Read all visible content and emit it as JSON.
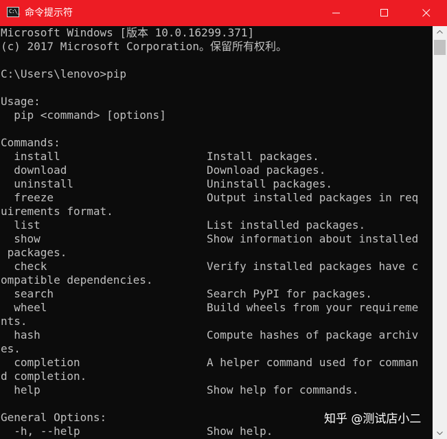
{
  "window": {
    "title": "命令提示符",
    "icon_text": "C:\\_"
  },
  "console": {
    "lines": [
      {
        "text": "Microsoft Windows [版本 10.0.16299.371]",
        "desc": ""
      },
      {
        "text": "(c) 2017 Microsoft Corporation。保留所有权利。",
        "desc": ""
      },
      {
        "text": "",
        "desc": ""
      },
      {
        "text": "C:\\Users\\lenovo>pip",
        "desc": ""
      },
      {
        "text": "",
        "desc": ""
      },
      {
        "text": "Usage:",
        "desc": ""
      },
      {
        "text": "  pip <command> [options]",
        "desc": ""
      },
      {
        "text": "",
        "desc": ""
      },
      {
        "text": "Commands:",
        "desc": ""
      },
      {
        "text": "  install",
        "desc": "Install packages."
      },
      {
        "text": "  download",
        "desc": "Download packages."
      },
      {
        "text": "  uninstall",
        "desc": "Uninstall packages."
      },
      {
        "text": "  freeze",
        "desc": "Output installed packages in req"
      },
      {
        "text": "uirements format.",
        "desc": ""
      },
      {
        "text": "  list",
        "desc": "List installed packages."
      },
      {
        "text": "  show",
        "desc": "Show information about installed"
      },
      {
        "text": " packages.",
        "desc": ""
      },
      {
        "text": "  check",
        "desc": "Verify installed packages have c"
      },
      {
        "text": "ompatible dependencies.",
        "desc": ""
      },
      {
        "text": "  search",
        "desc": "Search PyPI for packages."
      },
      {
        "text": "  wheel",
        "desc": "Build wheels from your requireme"
      },
      {
        "text": "nts.",
        "desc": ""
      },
      {
        "text": "  hash",
        "desc": "Compute hashes of package archiv"
      },
      {
        "text": "es.",
        "desc": ""
      },
      {
        "text": "  completion",
        "desc": "A helper command used for comman"
      },
      {
        "text": "d completion.",
        "desc": ""
      },
      {
        "text": "  help",
        "desc": "Show help for commands."
      },
      {
        "text": "",
        "desc": ""
      },
      {
        "text": "General Options:",
        "desc": ""
      },
      {
        "text": "  -h, --help",
        "desc": "Show help."
      }
    ]
  },
  "watermark": "知乎 @测试店小二",
  "colors": {
    "titlebar": "#ed1c24",
    "console_bg": "#0c0c0c",
    "console_fg": "#c0c0c0",
    "scrollbar_bg": "#f0f0f0",
    "scrollbar_thumb": "#c1c1c1"
  }
}
